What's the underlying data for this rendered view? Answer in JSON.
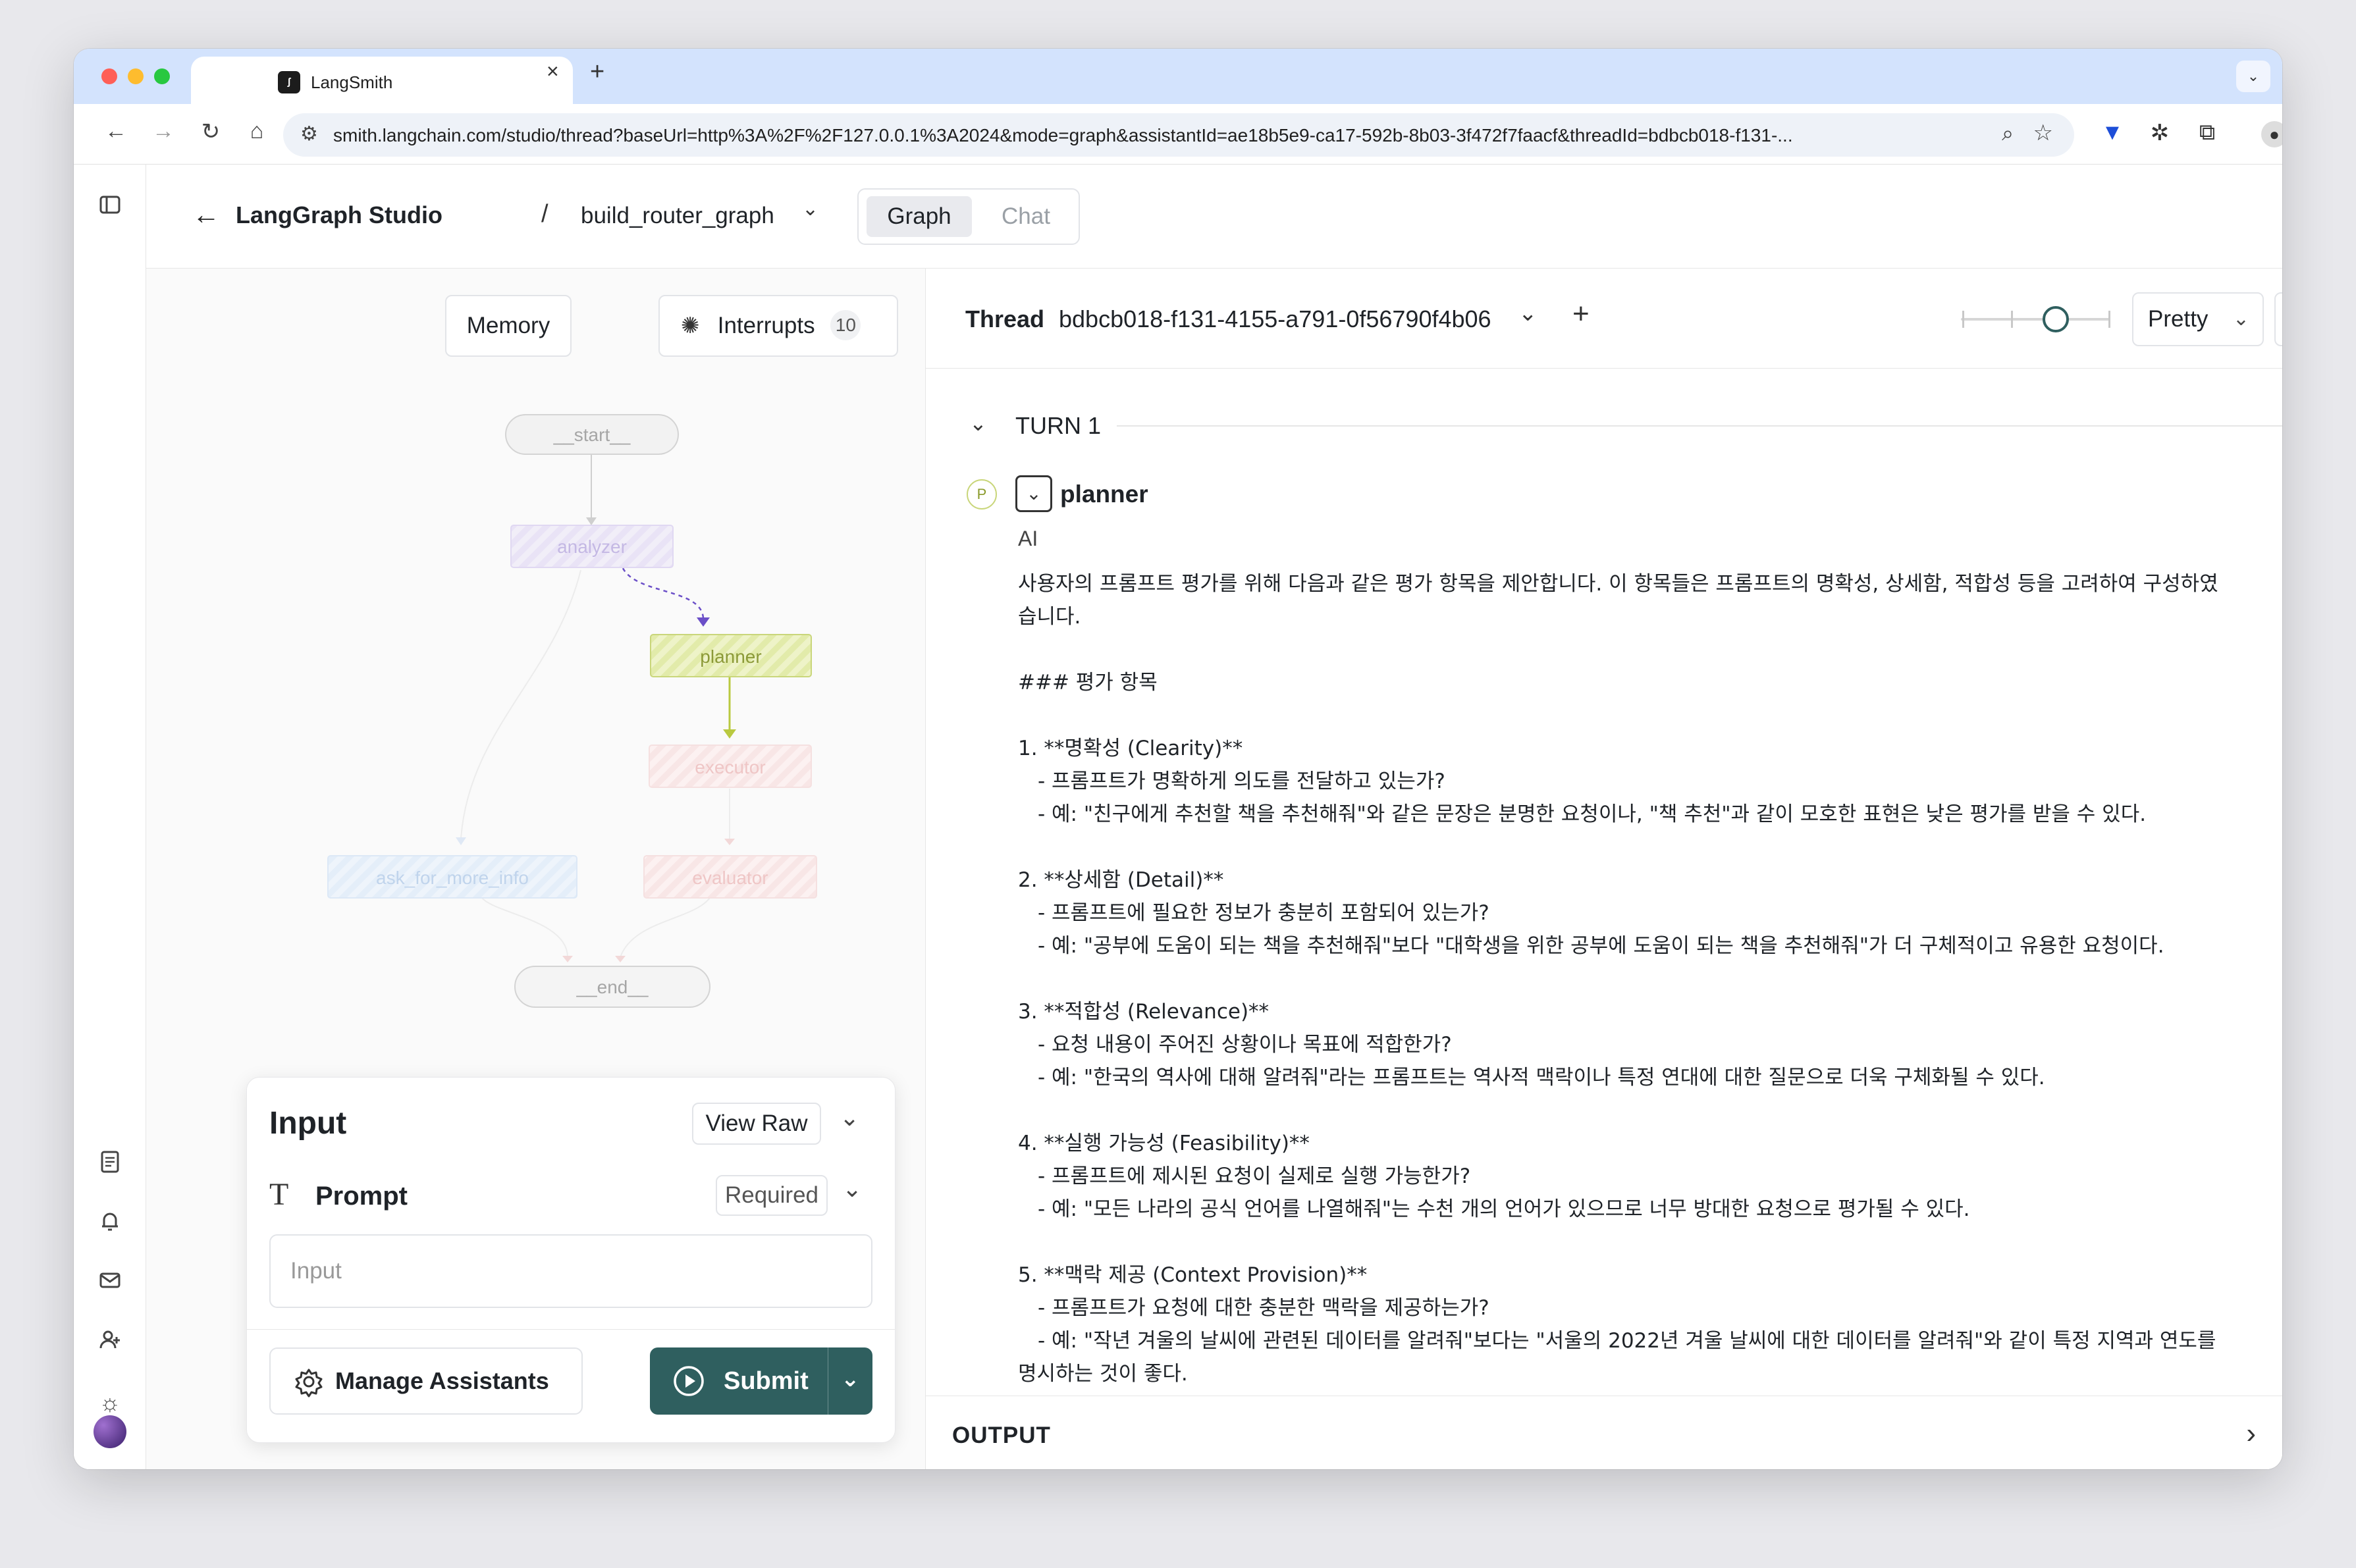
{
  "browser": {
    "tab_title": "LangSmith",
    "tab_close": "×",
    "new_tab": "+",
    "url": "smith.langchain.com/studio/thread?baseUrl=http%3A%2F%2F127.0.0.1%3A2024&mode=graph&assistantId=ae18b5e9-ca17-592b-8b03-3f472f7faacf&threadId=bdbcb018-f131-..."
  },
  "header": {
    "app_title": "LangGraph Studio",
    "separator": "/",
    "graph_name": "build_router_graph",
    "view_tabs": {
      "graph": "Graph",
      "chat": "Chat"
    },
    "active_view": "Graph"
  },
  "graph_panel": {
    "memory_label": "Memory",
    "interrupts_label": "Interrupts",
    "interrupts_count": "10",
    "nodes": {
      "start": "__start__",
      "analyzer": "analyzer",
      "planner": "planner",
      "executor": "executor",
      "ask_for_more_info": "ask_for_more_info",
      "evaluator": "evaluator",
      "end": "__end__"
    },
    "active_node": "planner"
  },
  "input_card": {
    "title": "Input",
    "view_raw_label": "View Raw",
    "prompt_label": "Prompt",
    "required_label": "Required",
    "input_placeholder": "Input",
    "manage_assistants_label": "Manage Assistants",
    "submit_label": "Submit"
  },
  "thread": {
    "label": "Thread",
    "id": "bdbcb018-f131-4155-a791-0f56790f4b06",
    "format": "Pretty",
    "turn_label": "TURN 1",
    "node_badge": "P",
    "node_name": "planner",
    "role": "AI",
    "message_lines": [
      "사용자의 프롬프트 평가를 위해 다음과 같은 평가 항목을 제안합니다. 이 항목들은 프롬프트의 명확성, 상세함, 적합성 등을 고려하여 구성하였",
      "습니다.",
      "",
      "### 평가 항목",
      "",
      "1. **명확성 (Clearity)**",
      "   - 프롬프트가 명확하게 의도를 전달하고 있는가?",
      "   - 예: \"친구에게 추천할 책을 추천해줘\"와 같은 문장은 분명한 요청이나, \"책 추천\"과 같이 모호한 표현은 낮은 평가를 받을 수 있다.",
      "",
      "2. **상세함 (Detail)**",
      "   - 프롬프트에 필요한 정보가 충분히 포함되어 있는가?",
      "   - 예: \"공부에 도움이 되는 책을 추천해줘\"보다 \"대학생을 위한 공부에 도움이 되는 책을 추천해줘\"가 더 구체적이고 유용한 요청이다.",
      "",
      "3. **적합성 (Relevance)**",
      "   - 요청 내용이 주어진 상황이나 목표에 적합한가?",
      "   - 예: \"한국의 역사에 대해 알려줘\"라는 프롬프트는 역사적 맥락이나 특정 연대에 대한 질문으로 더욱 구체화될 수 있다.",
      "",
      "4. **실행 가능성 (Feasibility)**",
      "   - 프롬프트에 제시된 요청이 실제로 실행 가능한가?",
      "   - 예: \"모든 나라의 공식 언어를 나열해줘\"는 수천 개의 언어가 있으므로 너무 방대한 요청으로 평가될 수 있다.",
      "",
      "5. **맥락 제공 (Context Provision)**",
      "   - 프롬프트가 요청에 대한 충분한 맥락을 제공하는가?",
      "   - 예: \"작년 겨울의 날씨에 관련된 데이터를 알려줘\"보다는 \"서울의 2022년 겨울 날씨에 대한 데이터를 알려줘\"와 같이 특정 지역과 연도를",
      "명시하는 것이 좋다."
    ],
    "output_label": "OUTPUT"
  },
  "colors": {
    "submit_bg": "#2f5f5f",
    "planner_node": "#e3ecb0",
    "tabbar": "#d3e3fd"
  }
}
